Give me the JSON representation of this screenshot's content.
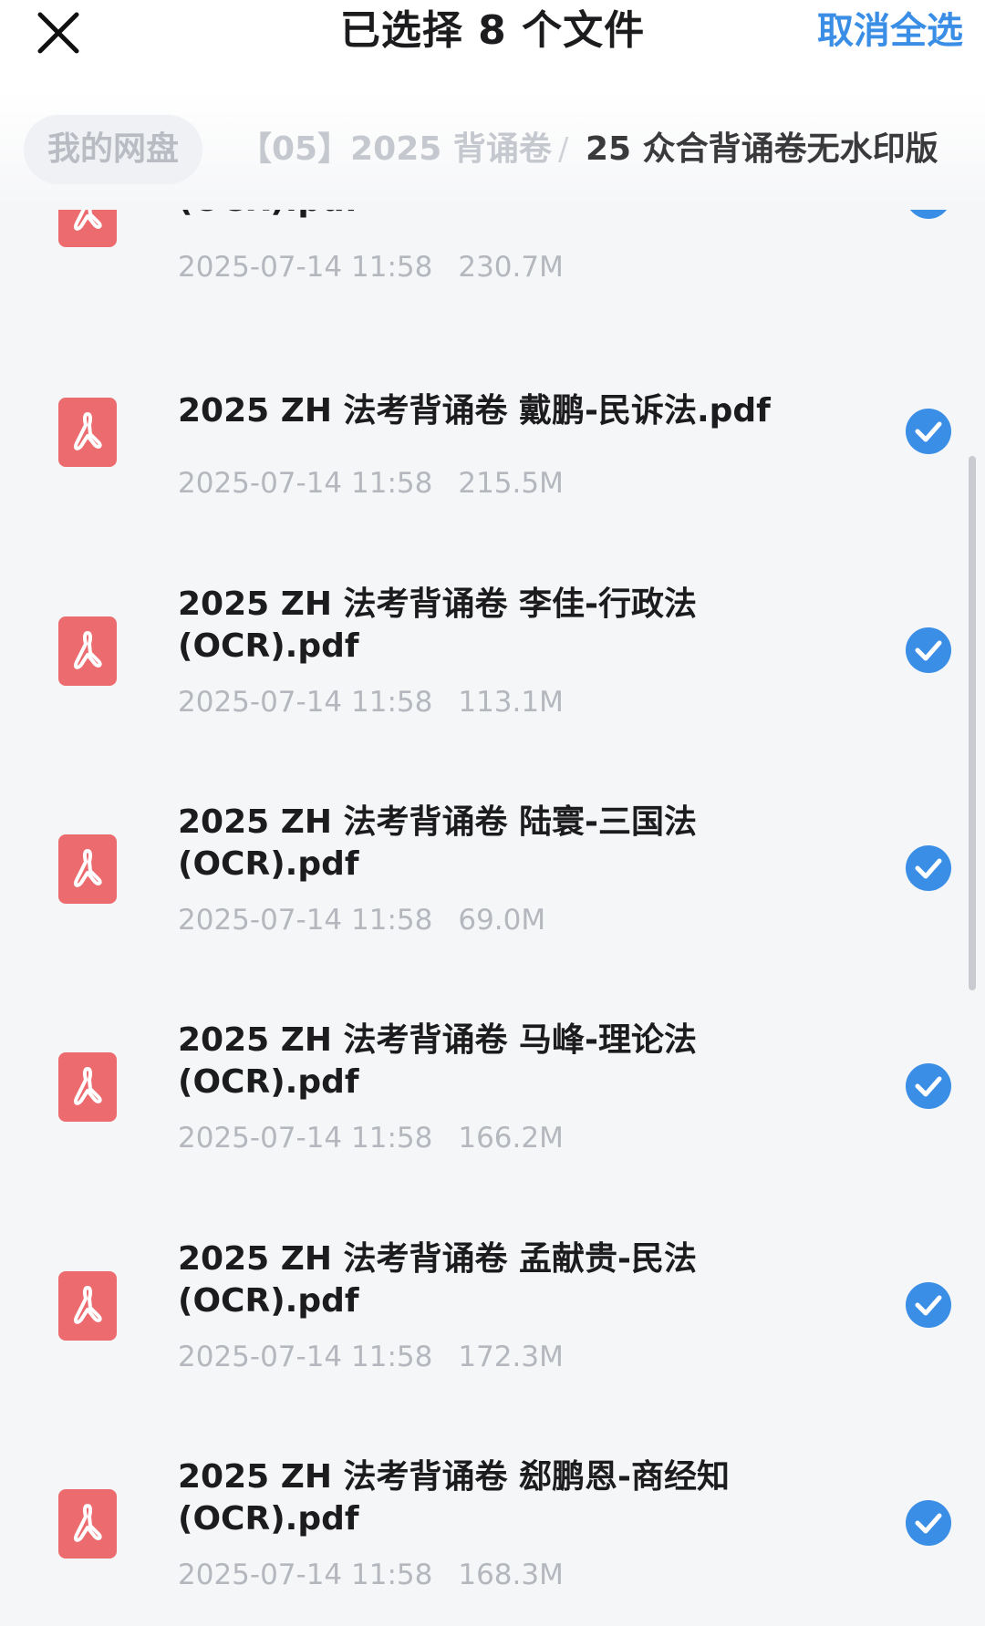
{
  "header": {
    "title": "已选择 8 个文件",
    "cancel_all_label": "取消全选"
  },
  "breadcrumb": {
    "root": "我的网盘",
    "middle": "【05】2025 背诵卷",
    "separator": "/",
    "current": "25 众合背诵卷无水印版"
  },
  "colors": {
    "accent": "#3a8ee6",
    "pdf_red": "#ec6b6f",
    "text_primary": "#1c1c1e",
    "text_secondary": "#b4b7bd",
    "background": "#f5f6f8"
  },
  "files": [
    {
      "name_line1": "",
      "name_line2": "(OCR).pdf",
      "date": "2025-07-14 11:58",
      "size": "230.7M",
      "selected": true,
      "icon": "pdf-icon"
    },
    {
      "name_line1": "2025 ZH 法考背诵卷 戴鹏-民诉法.pdf",
      "name_line2": "",
      "date": "2025-07-14 11:58",
      "size": "215.5M",
      "selected": true,
      "icon": "pdf-icon"
    },
    {
      "name_line1": "2025 ZH 法考背诵卷 李佳-行政法",
      "name_line2": "(OCR).pdf",
      "date": "2025-07-14 11:58",
      "size": "113.1M",
      "selected": true,
      "icon": "pdf-icon"
    },
    {
      "name_line1": "2025 ZH 法考背诵卷 陆寰-三国法",
      "name_line2": "(OCR).pdf",
      "date": "2025-07-14 11:58",
      "size": "69.0M",
      "selected": true,
      "icon": "pdf-icon"
    },
    {
      "name_line1": "2025 ZH 法考背诵卷 马峰-理论法",
      "name_line2": "(OCR).pdf",
      "date": "2025-07-14 11:58",
      "size": "166.2M",
      "selected": true,
      "icon": "pdf-icon"
    },
    {
      "name_line1": "2025 ZH 法考背诵卷 孟献贵-民法",
      "name_line2": "(OCR).pdf",
      "date": "2025-07-14 11:58",
      "size": "172.3M",
      "selected": true,
      "icon": "pdf-icon"
    },
    {
      "name_line1": "2025 ZH 法考背诵卷 郄鹏恩-商经知",
      "name_line2": "(OCR).pdf",
      "date": "2025-07-14 11:58",
      "size": "168.3M",
      "selected": true,
      "icon": "pdf-icon"
    }
  ]
}
